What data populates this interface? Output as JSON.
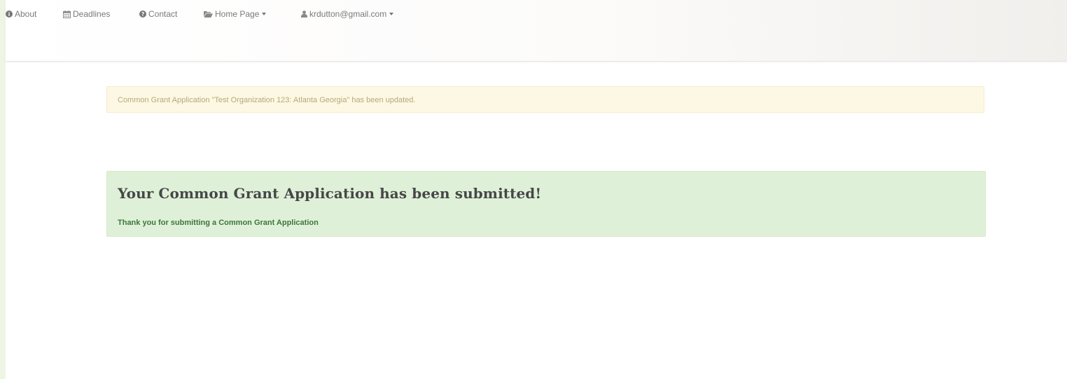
{
  "nav": {
    "about": {
      "label": "About",
      "icon": "info-circle-icon"
    },
    "deadlines": {
      "label": "Deadlines",
      "icon": "calendar-icon"
    },
    "contact": {
      "label": "Contact",
      "icon": "question-circle-icon"
    },
    "home_page": {
      "label": "Home Page",
      "icon": "folder-open-icon"
    },
    "user": {
      "label": "krdutton@gmail.com",
      "icon": "user-icon"
    }
  },
  "alerts": {
    "update_message": "Common Grant Application \"Test Organization 123: Atlanta Georgia\" has been updated.",
    "success_title": "Your Common Grant Application has been submitted!",
    "success_message": "Thank you for submitting a Common Grant Application"
  },
  "colors": {
    "page_background": "#eef5e4",
    "warning_background": "#fcf8e3",
    "warning_border": "#faebcc",
    "success_background": "#dff0d8",
    "success_border": "#d6e9c6",
    "success_text": "#3c763d",
    "nav_text": "#7a7a7a"
  }
}
